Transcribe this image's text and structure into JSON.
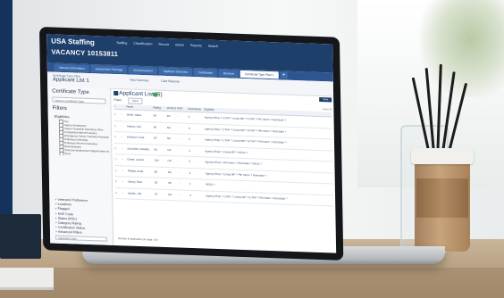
{
  "app": {
    "brand": "USA Staffing",
    "nav": [
      "Staffing",
      "Classification",
      "Recruit",
      "Admin",
      "Reports",
      "Search"
    ],
    "vacancy": "VACANCY 10153811"
  },
  "tabs": [
    {
      "label": "Vacancy Information"
    },
    {
      "label": "Assessment Package"
    },
    {
      "label": "Announcement"
    },
    {
      "label": "Applicant Overview"
    },
    {
      "label": "Certificates"
    },
    {
      "label": "Reviews"
    },
    {
      "label": "Certificate Type Filter 1",
      "active": true
    }
  ],
  "subheader": {
    "label": "Certificate Type Filter",
    "title": "Applicant List 1",
    "links": [
      "View Summary",
      "Card Selection"
    ]
  },
  "left_panel": {
    "certificate_type_title": "Certificate Type",
    "select_placeholder": "Select a Certificate Type",
    "filters_title": "Filters",
    "eligibilities_title": "Eligibilities",
    "eligibility_options": [
      "Any",
      "Agency Employees",
      "Career Transition Assistance Plan",
      "Competitive Merit Promotion",
      "Emergency Career Transition Assistance Plan",
      "Pathways Internship",
      "Pathways Recent Graduates",
      "Reinstatement",
      "Veterans Employment Opportunities Act",
      "None"
    ],
    "filter_groups": [
      "Veterans' Preference",
      "Locations",
      "Flagged",
      "HOF Code",
      "Status (RSC)",
      "Category Rating",
      "Certification Status",
      "Advanced Filters"
    ],
    "application_date_label": "Application Date",
    "application_date_placeholder": "Application Date"
  },
  "main": {
    "title": "Applicant List (6)",
    "filters_label": "Filters:",
    "filters_button": "Apply",
    "save_button": "Save",
    "select_all": "Select All",
    "columns": [
      "Name",
      "Rating",
      "Vet Pref",
      "RTD",
      "Documents",
      "Eligibility"
    ],
    "rows": [
      {
        "name": "Smith, Alexa",
        "rating": "88",
        "vet": "XP",
        "rtd": "-",
        "docs": "2",
        "elig": "Agency Emp ? CTAP ? Comp MP ? ICTAP ? Pth Intern ? Reinstate ?"
      },
      {
        "name": "Adams, Ann",
        "rating": "90",
        "vet": "NV",
        "rtd": "-",
        "docs": "3",
        "elig": "Agency Emp ? CTAP ? Comp MP ? ICTAP ? Pth Intern ? Reinstate ?"
      },
      {
        "name": "Erickson, Kate",
        "rating": "85",
        "vet": "NV",
        "rtd": "-",
        "docs": "4",
        "elig": "Agency Emp ? CTAP ? Comp MP ? ICTAP ? Pth Intern ? Reinstate ?"
      },
      {
        "name": "Gonzalez, Rosetta",
        "rating": "94",
        "vet": "CP",
        "rtd": "-",
        "docs": "1",
        "elig": "Agency Emp ? Comp MP ? VEOA ?"
      },
      {
        "name": "Driver, Leonis",
        "rating": "100",
        "vet": "CP",
        "rtd": "-",
        "docs": "5",
        "elig": "Agency Emp ? Pth Intern ? Reinstate ? VEOA ?"
      },
      {
        "name": "Phelps, Anita",
        "rating": "80",
        "vet": "NV",
        "rtd": "-",
        "docs": "2",
        "elig": "Agency Emp ? Comp MP ? Pth Intern ? Reinstate ?"
      },
      {
        "name": "Sunny, Paul",
        "rating": "92",
        "vet": "XP",
        "rtd": "-",
        "docs": "1",
        "elig": "VEOA ?"
      },
      {
        "name": "Hanks, Joe",
        "rating": "87",
        "vet": "NV",
        "rtd": "-",
        "docs": "3",
        "elig": "Agency Emp ? CTAP ? Comp MP ? ICTAP ? Pth Intern ? Reinstate ?"
      }
    ],
    "pager": "Number of applicants per page: 100"
  }
}
